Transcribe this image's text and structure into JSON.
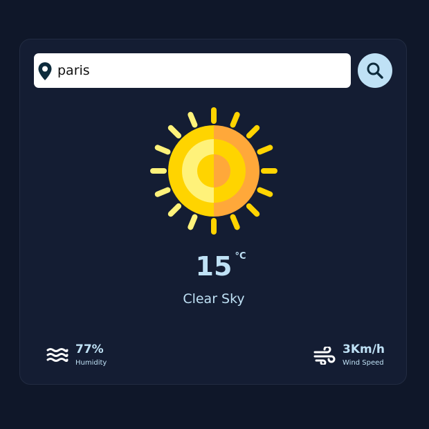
{
  "search": {
    "value": "paris",
    "icon": "map-pin-icon",
    "button_icon": "search-icon"
  },
  "weather": {
    "icon": "sun-icon",
    "temperature": "15",
    "unit": "°C",
    "condition": "Clear Sky"
  },
  "stats": {
    "humidity": {
      "value": "77%",
      "label": "Humidity",
      "icon": "waves-icon"
    },
    "wind": {
      "value": "3Km/h",
      "label": "Wind Speed",
      "icon": "wind-icon"
    }
  },
  "colors": {
    "page_background": "#0f1729",
    "card_background": "#141d33",
    "accent": "#bfe1f5",
    "sun_yellow": "#ffd400",
    "sun_orange": "#ffa83a"
  }
}
